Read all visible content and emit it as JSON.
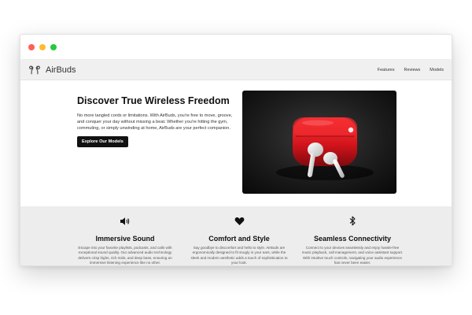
{
  "colors": {
    "close_dot": "#ff5f57",
    "minimize_dot": "#febc2e",
    "maximize_dot": "#28c840",
    "cta_bg": "#111111",
    "case_red": "#d4141c"
  },
  "navbar": {
    "brand": "AirBuds",
    "links": [
      "Features",
      "Reviews",
      "Models"
    ]
  },
  "hero": {
    "title": "Discover True Wireless Freedom",
    "description": "No more tangled cords or limitations. With AirBuds, you're free to move, groove, and conquer your day without missing a beat. Whether you're hitting the gym, commuting, or simply unwinding at home, AirBuds are your perfect companion.",
    "cta_label": "Explore Our Models"
  },
  "features": [
    {
      "icon": "speaker-icon",
      "title": "Immersive Sound",
      "description": "Escape into your favorite playlists, podcasts, and calls with exceptional sound quality. Our advanced audio technology delivers crisp highs, rich mids, and deep bass, ensuring an immersive listening experience like no other."
    },
    {
      "icon": "heart-icon",
      "title": "Comfort and Style",
      "description": "Say goodbye to discomfort and hello to style. AirBuds are ergonomically designed to fit snugly in your ears, while the sleek and modern aesthetic adds a touch of sophistication to your look."
    },
    {
      "icon": "bluetooth-icon",
      "title": "Seamless Connectivity",
      "description": "Connect to your devices seamlessly and enjoy hassle-free music playback, call management, and voice assistant support. With intuitive touch controls, navigating your audio experience has never been easier."
    }
  ]
}
